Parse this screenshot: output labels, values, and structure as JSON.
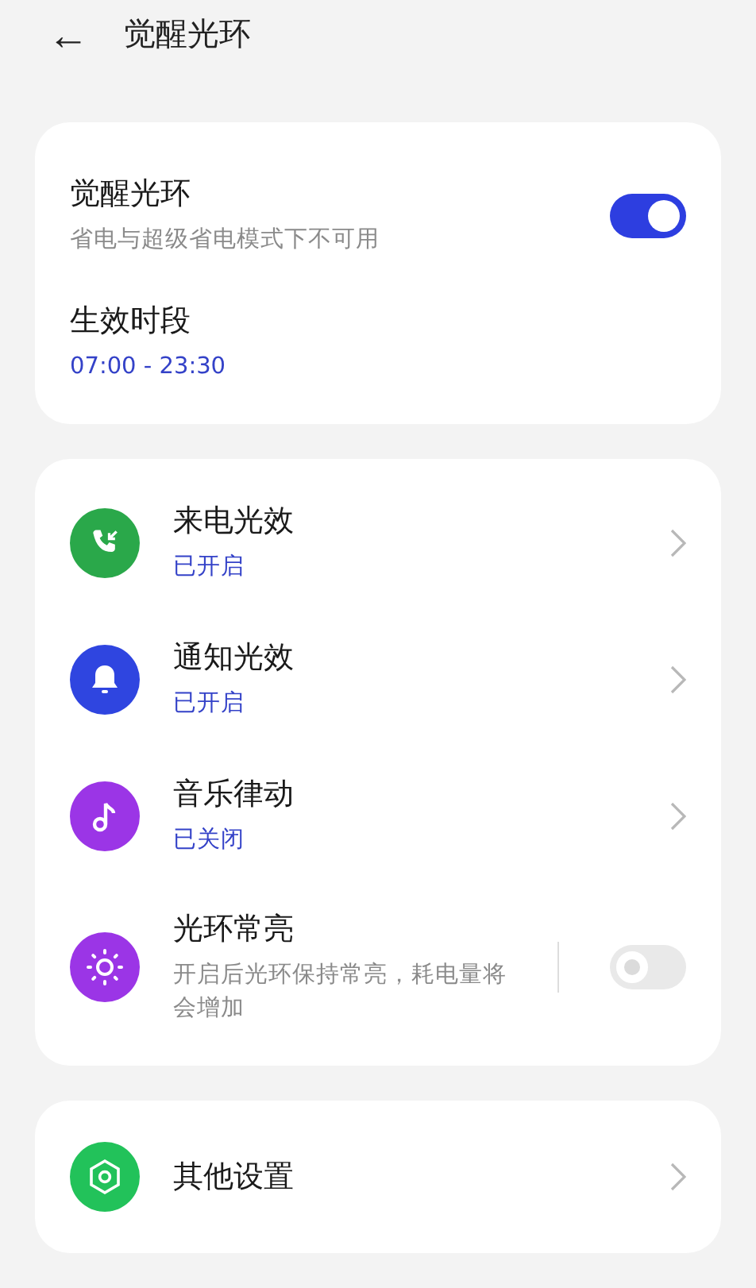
{
  "header": {
    "back": "←",
    "title": "觉醒光环"
  },
  "main_card": {
    "toggle_row": {
      "title": "觉醒光环",
      "subtitle": "省电与超级省电模式下不可用",
      "on": true
    },
    "time_row": {
      "title": "生效时段",
      "value": "07:00 - 23:30"
    }
  },
  "effects": [
    {
      "kind": "link",
      "title": "来电光效",
      "status": "已开启",
      "color": "#2aa84a"
    },
    {
      "kind": "link",
      "title": "通知光效",
      "status": "已开启",
      "color": "#2f45e0"
    },
    {
      "kind": "link",
      "title": "音乐律动",
      "status": "已关闭",
      "color": "#9b35e6"
    },
    {
      "kind": "toggle",
      "title": "光环常亮",
      "description": "开启后光环保持常亮，耗电量将会增加",
      "color": "#9b35e6",
      "on": false,
      "disabled": true
    }
  ],
  "other": {
    "title": "其他设置",
    "color": "#22c25a"
  }
}
